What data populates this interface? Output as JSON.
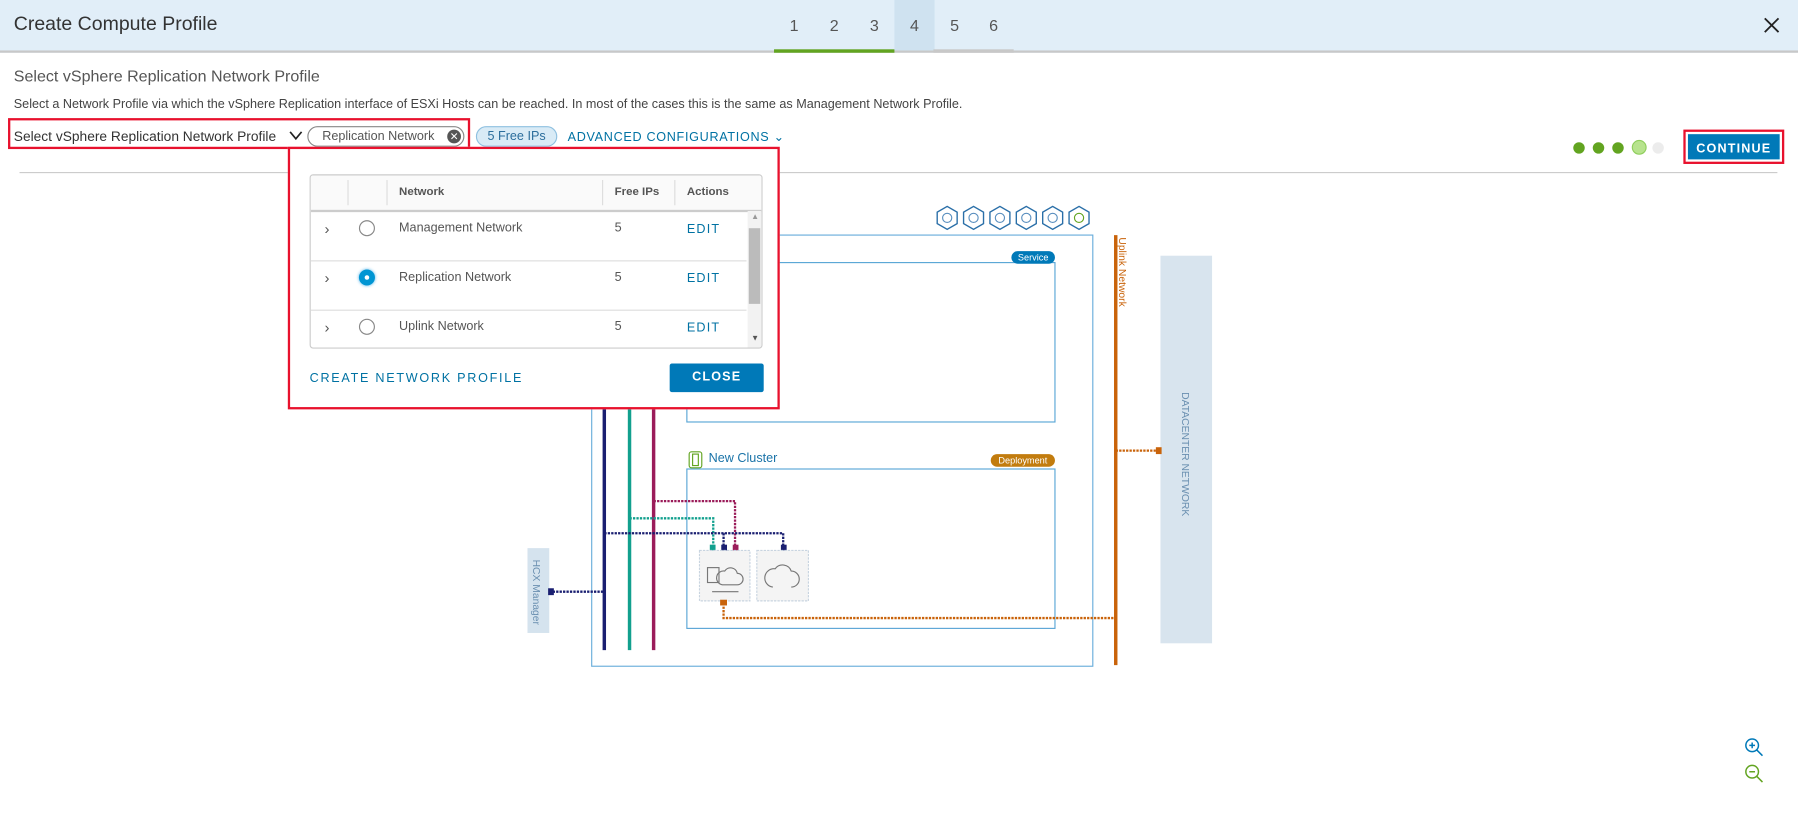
{
  "header": {
    "title": "Create Compute Profile",
    "steps": [
      "1",
      "2",
      "3",
      "4",
      "5",
      "6"
    ],
    "active_step": 4,
    "close_icon": "close-icon"
  },
  "page": {
    "heading": "Select vSphere Replication Network Profile",
    "description": "Select a Network Profile via which the vSphere Replication interface of ESXi Hosts can be reached. In most of the cases this is the same as Management Network Profile."
  },
  "selector": {
    "label": "Select vSphere Replication Network Profile",
    "selected": "Replication Network",
    "free_ips": "5 Free IPs",
    "advanced": "ADVANCED CONFIGURATIONS"
  },
  "progress": {
    "completed": 3,
    "current": 4,
    "total": 5
  },
  "continue_label": "CONTINUE",
  "popup": {
    "columns": [
      "Network",
      "Free IPs",
      "Actions"
    ],
    "rows": [
      {
        "network": "Management Network",
        "free_ips": "5",
        "action": "EDIT",
        "selected": false
      },
      {
        "network": "Replication Network",
        "free_ips": "5",
        "action": "EDIT",
        "selected": true
      },
      {
        "network": "Uplink Network",
        "free_ips": "5",
        "action": "EDIT",
        "selected": false
      }
    ],
    "create_label": "CREATE NETWORK PROFILE",
    "close_label": "CLOSE"
  },
  "diagram": {
    "service_badge": "Service",
    "cluster_name": "New Cluster",
    "deployment_badge": "Deployment",
    "hcx_manager": "HCX Manager",
    "uplink": "Uplink Network",
    "datacenter": "DATACENTER NETWORK",
    "service_icons": [
      "power-icon",
      "migration-icon",
      "network-extension-icon",
      "wan-optimization-icon",
      "cloud-icon",
      "globe-icon"
    ]
  },
  "colors": {
    "accent": "#0079b8",
    "green": "#62a420",
    "highlight": "#e8112d",
    "uplink": "#c9630a",
    "mgmt": "#1a1f71",
    "vmotion": "#12a08e",
    "replication": "#9b1c5a"
  }
}
